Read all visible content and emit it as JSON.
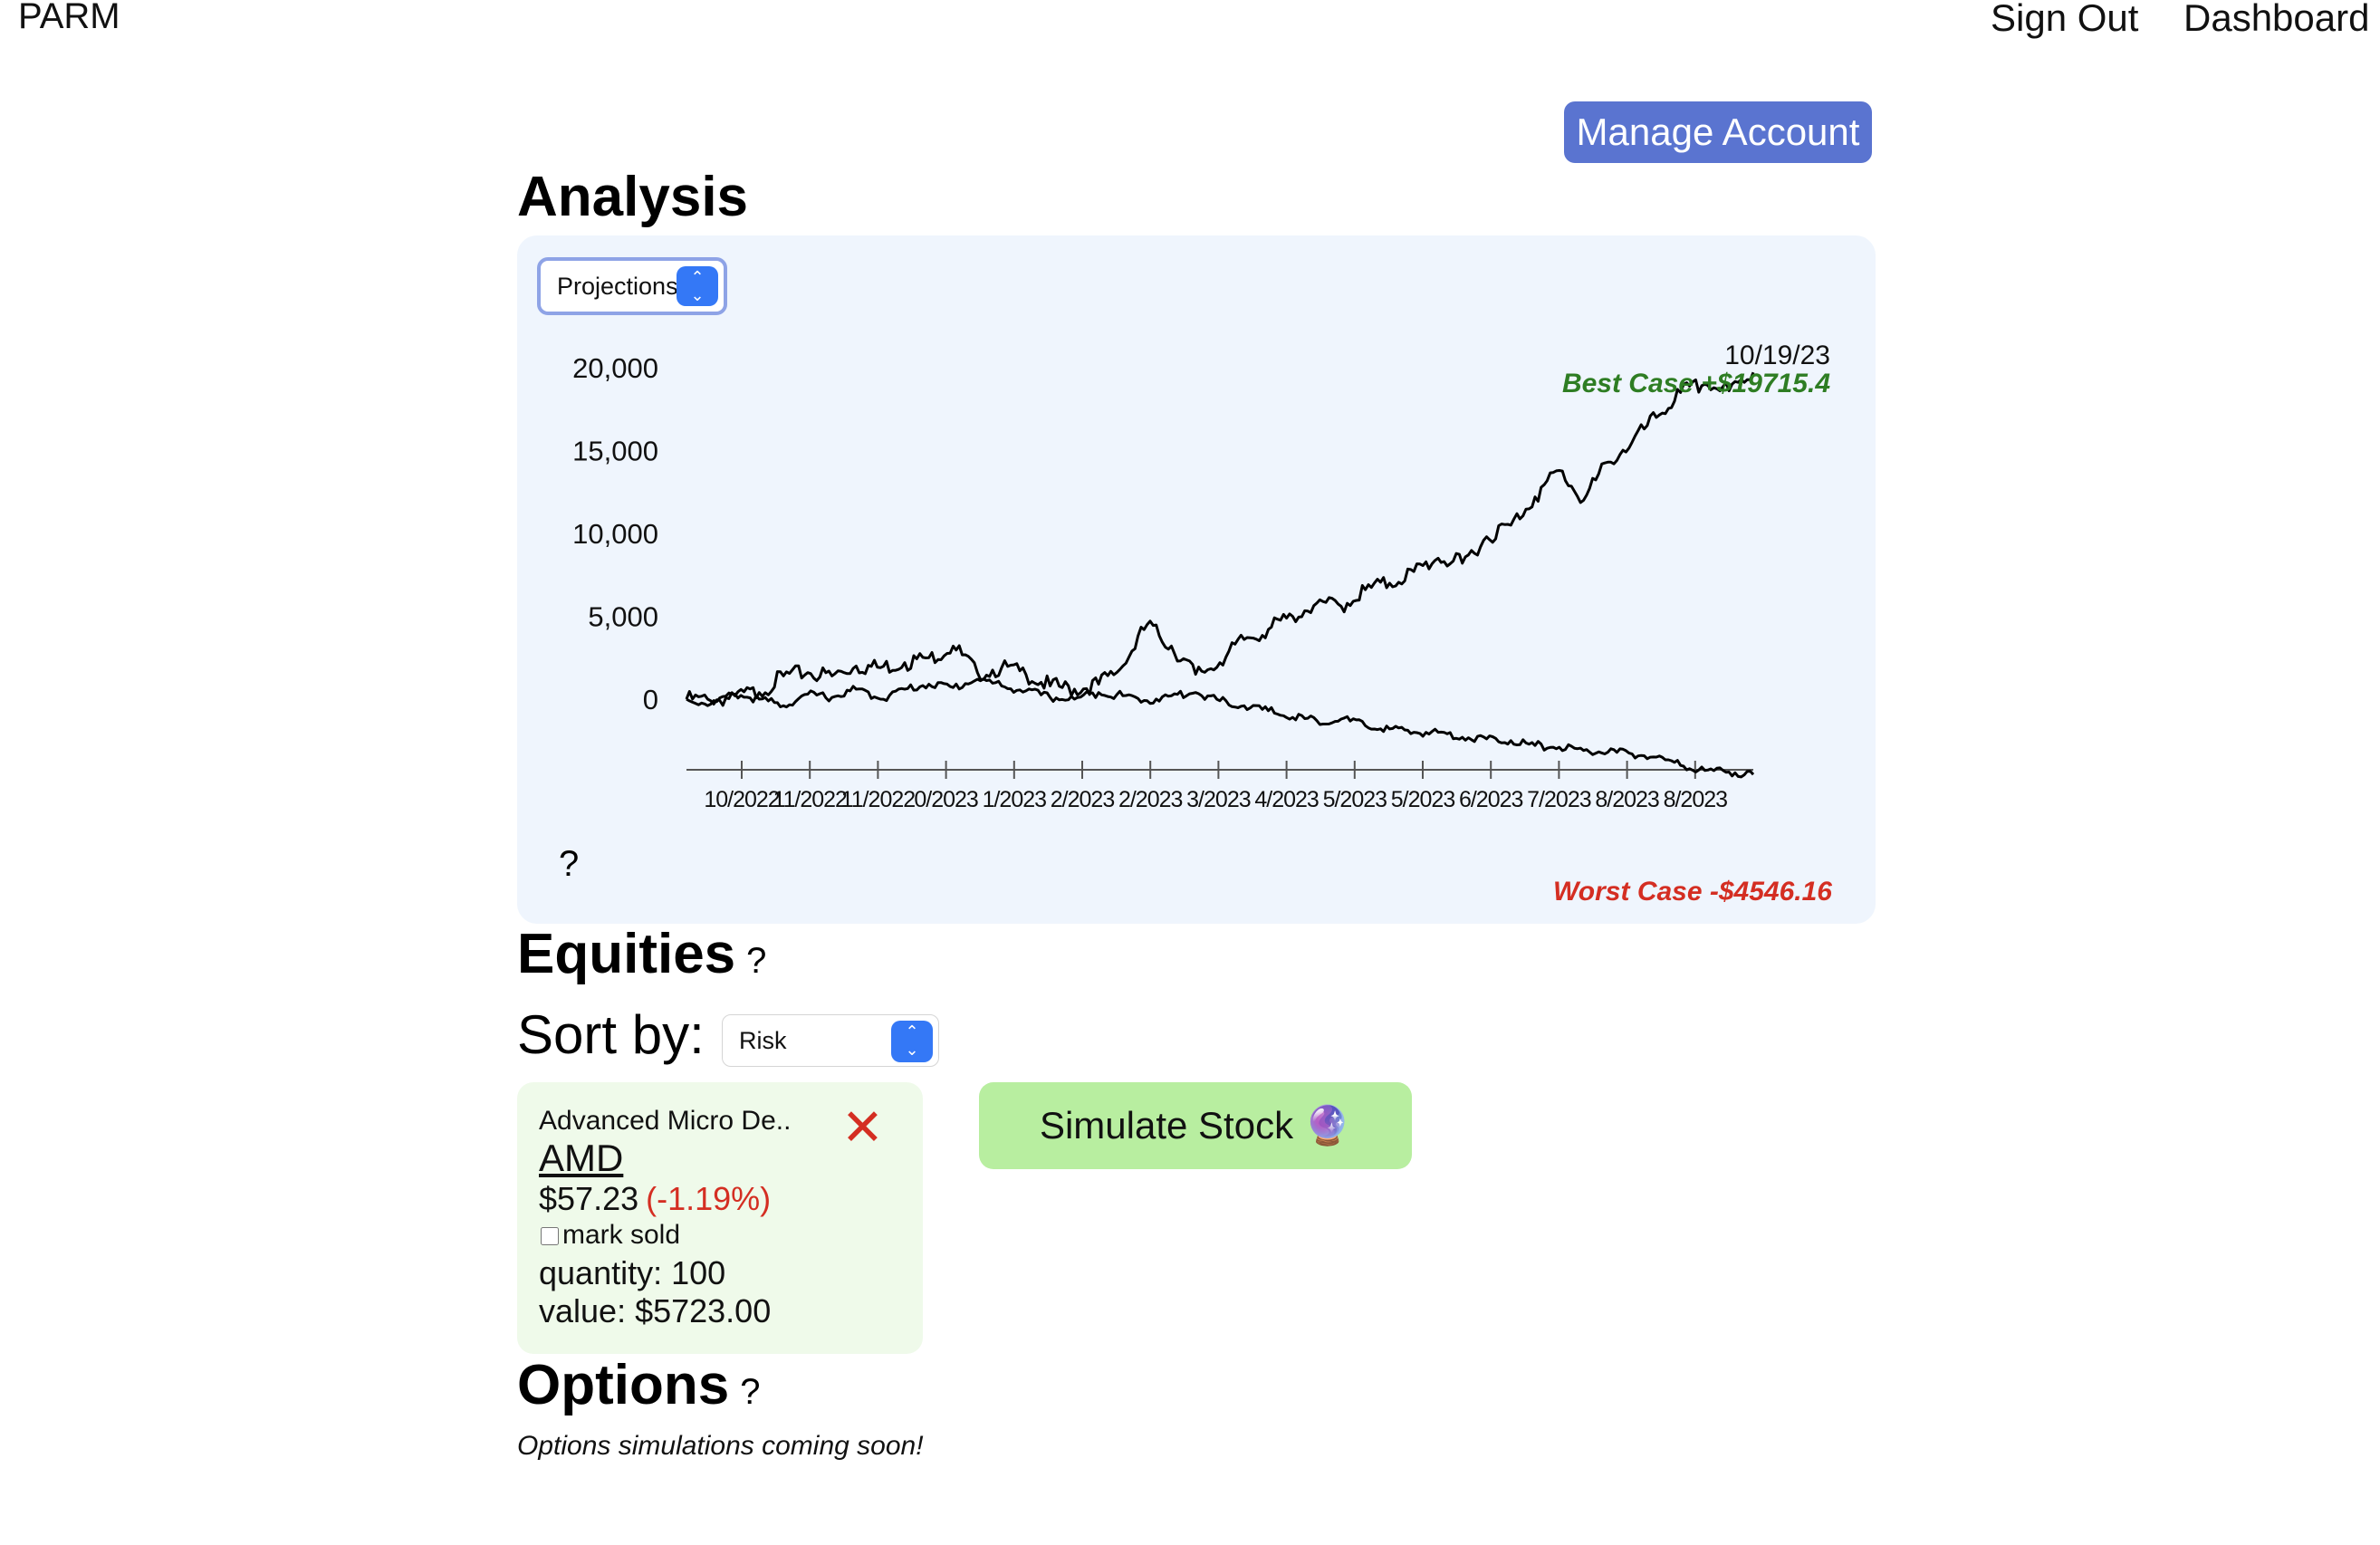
{
  "nav": {
    "brand": "PARM",
    "sign_out": "Sign Out",
    "dashboard": "Dashboard"
  },
  "manage_account": "Manage Account",
  "analysis": {
    "title": "Analysis",
    "view_select": "Projections",
    "help": "?",
    "date_label": "10/19/23",
    "best_case": "Best Case +$19715.4",
    "worst_case": "Worst Case -$4546.16"
  },
  "chart_data": {
    "type": "line",
    "yticks": [
      0,
      5000,
      10000,
      15000,
      20000
    ],
    "ytick_labels": [
      "0",
      "5,000",
      "10,000",
      "15,000",
      "20,000"
    ],
    "xtick_labels": [
      "10/2022",
      "11/2022",
      "11/2022",
      "0/2023",
      "1/2023",
      "2/2023",
      "2/2023",
      "3/2023",
      "4/2023",
      "5/2023",
      "5/2023",
      "6/2023",
      "7/2023",
      "8/2023",
      "8/2023"
    ],
    "grid": false,
    "series": [
      {
        "values": [
          0,
          -100,
          200,
          400,
          1400,
          1600,
          1400,
          2000,
          1900,
          2200,
          2500,
          3200,
          1600,
          1900,
          1500,
          800,
          600,
          900,
          2000,
          4500,
          3200,
          1500,
          2200,
          3600,
          4200,
          5000,
          5800,
          5600,
          6600,
          7000,
          7700,
          8500,
          8200,
          9800,
          10500,
          12200,
          13800,
          12000,
          14300,
          15500,
          17000,
          18500,
          19000,
          18600,
          19715.4
        ]
      },
      {
        "values": [
          0,
          -300,
          300,
          0,
          -400,
          300,
          100,
          600,
          0,
          600,
          900,
          700,
          1200,
          800,
          500,
          100,
          0,
          400,
          200,
          -100,
          200,
          400,
          -100,
          -400,
          -700,
          -1100,
          -1300,
          -1200,
          -1600,
          -1800,
          -2000,
          -2000,
          -2300,
          -2400,
          -2500,
          -2800,
          -2900,
          -3100,
          -3200,
          -3300,
          -3500,
          -4000,
          -4300,
          -4400,
          -4546.16
        ]
      }
    ]
  },
  "equities": {
    "title": "Equities",
    "help": "?",
    "sort_label": "Sort by:",
    "sort_value": "Risk",
    "card": {
      "name": "Advanced Micro De..",
      "ticker": "AMD",
      "price": "$57.23",
      "change": "(-1.19%)",
      "sold_label": "mark sold",
      "quantity": "quantity: 100",
      "value": "value: $5723.00"
    },
    "simulate_button": "Simulate Stock 🔮"
  },
  "options": {
    "title": "Options",
    "help": "?",
    "message": "Options simulations coming soon!"
  }
}
